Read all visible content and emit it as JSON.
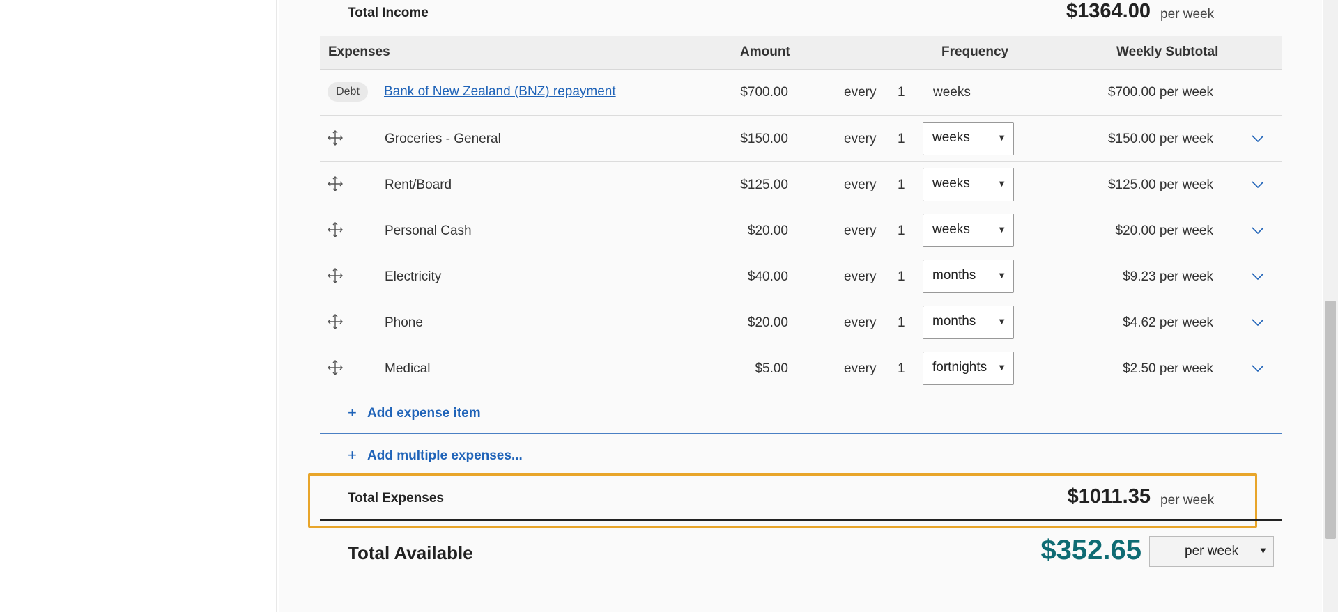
{
  "income": {
    "label": "Total Income",
    "amount": "$1364.00",
    "period": "per week"
  },
  "expenses_table": {
    "headers": {
      "expenses": "Expenses",
      "amount": "Amount",
      "frequency": "Frequency",
      "weekly_subtotal": "Weekly Subtotal"
    },
    "debt_row": {
      "badge": "Debt",
      "name": "Bank of New Zealand (BNZ) repayment",
      "amount": "$700.00",
      "every": "every",
      "count": "1",
      "unit": "weeks",
      "subtotal": "$700.00 per week"
    },
    "rows": [
      {
        "name": "Groceries - General",
        "amount": "$150.00",
        "every": "every",
        "count": "1",
        "unit": "weeks",
        "subtotal": "$150.00 per week"
      },
      {
        "name": "Rent/Board",
        "amount": "$125.00",
        "every": "every",
        "count": "1",
        "unit": "weeks",
        "subtotal": "$125.00 per week"
      },
      {
        "name": "Personal Cash",
        "amount": "$20.00",
        "every": "every",
        "count": "1",
        "unit": "weeks",
        "subtotal": "$20.00 per week"
      },
      {
        "name": "Electricity",
        "amount": "$40.00",
        "every": "every",
        "count": "1",
        "unit": "months",
        "subtotal": "$9.23 per week"
      },
      {
        "name": "Phone",
        "amount": "$20.00",
        "every": "every",
        "count": "1",
        "unit": "months",
        "subtotal": "$4.62 per week"
      },
      {
        "name": "Medical",
        "amount": "$5.00",
        "every": "every",
        "count": "1",
        "unit": "fortnights",
        "subtotal": "$2.50 per week"
      }
    ],
    "add_expense_label": "Add expense item",
    "add_multiple_label": "Add multiple expenses..."
  },
  "total_expenses": {
    "label": "Total Expenses",
    "amount": "$1011.35",
    "period": "per week"
  },
  "total_available": {
    "label": "Total Available",
    "amount": "$352.65",
    "period_select": "per week"
  },
  "icons": {
    "move": "move-icon",
    "chevron": "chevron-down-icon",
    "plus": "plus-icon",
    "dropdown": "dropdown-arrow-icon"
  },
  "colors": {
    "link": "#1f63b8",
    "available_amount": "#0e6b73",
    "highlight": "#e8a52a"
  }
}
